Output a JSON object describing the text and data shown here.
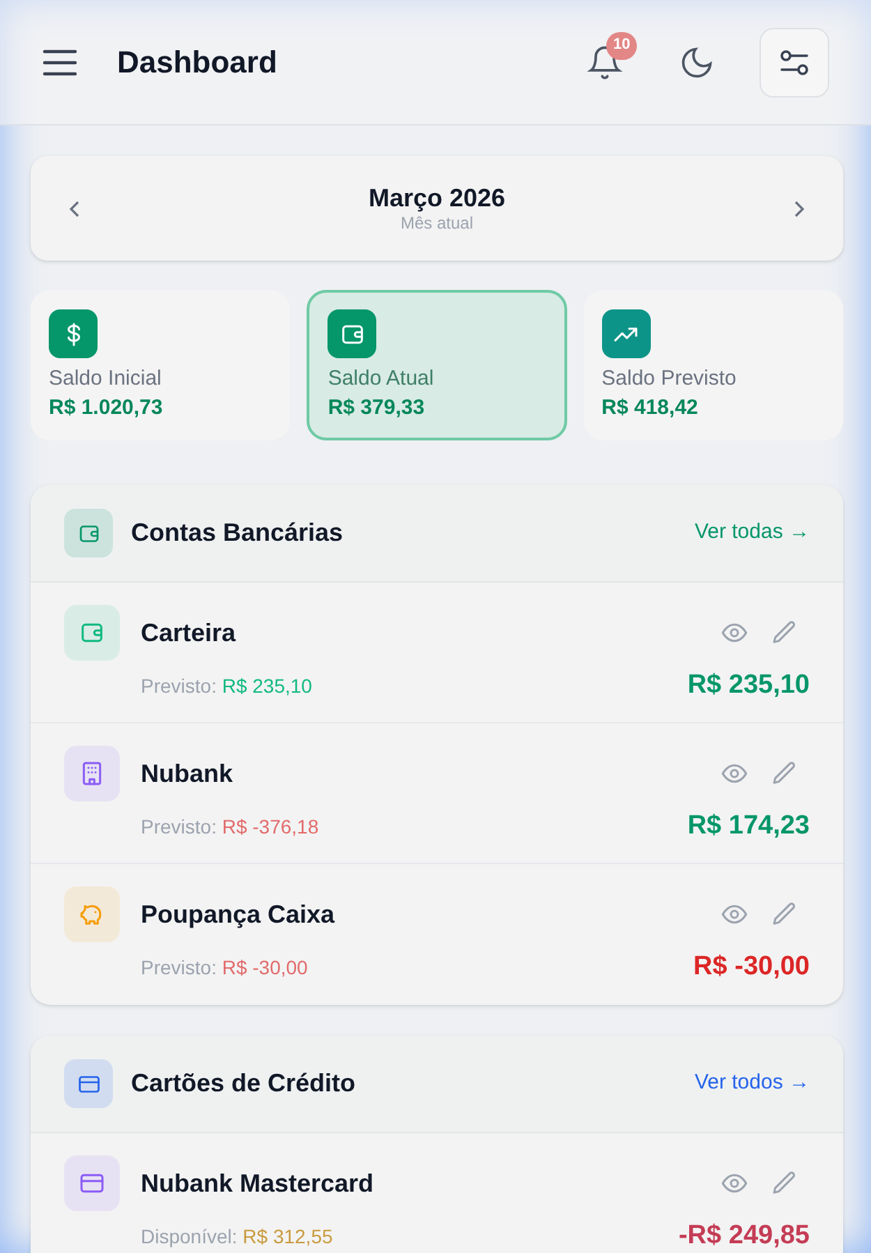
{
  "header": {
    "title": "Dashboard",
    "notification_count": "10"
  },
  "month_nav": {
    "month": "Março 2026",
    "subtitle": "Mês atual"
  },
  "summary_cards": [
    {
      "kind": "dollar",
      "label": "Saldo Inicial",
      "value": "R$ 1.020,73",
      "selected": false
    },
    {
      "kind": "wallet",
      "label": "Saldo Atual",
      "value": "R$ 379,33",
      "selected": true
    },
    {
      "kind": "trend",
      "label": "Saldo Previsto",
      "value": "R$ 418,42",
      "selected": false
    }
  ],
  "sections": [
    {
      "kind": "wallet",
      "color": "#059669",
      "title": "Contas Bancárias",
      "link": "Ver todas →",
      "items": [
        {
          "kind": "wallet",
          "color": "#10b981",
          "name": "Carteira",
          "sub_label": "Previsto:",
          "sub_value": {
            "text": "R$ 235,10",
            "color": "#10b981"
          },
          "amount": {
            "text": "R$ 235,10",
            "color": "#059669"
          }
        },
        {
          "kind": "building",
          "color": "#8b5cf6",
          "name": "Nubank",
          "sub_label": "Previsto:",
          "sub_value": {
            "text": "R$ -376,18",
            "color": "#e26a6a"
          },
          "amount": {
            "text": "R$ 174,23",
            "color": "#059669"
          }
        },
        {
          "kind": "piggy",
          "color": "#f59e0b",
          "name": "Poupança Caixa",
          "sub_label": "Previsto:",
          "sub_value": {
            "text": "R$ -30,00",
            "color": "#e26a6a"
          },
          "amount": {
            "text": "R$ -30,00",
            "color": "#dc2626"
          }
        }
      ]
    },
    {
      "kind": "card",
      "color": "#2563eb",
      "title": "Cartões de Crédito",
      "link": "Ver todos →",
      "items": [
        {
          "kind": "card",
          "color": "#8b5cf6",
          "name": "Nubank Mastercard",
          "sub_label": "Disponível:",
          "sub_value": {
            "text": "R$ 312,55",
            "color": "#c99a3e"
          },
          "amount": {
            "text": "-R$ 249,85",
            "color": "#c43c55"
          }
        }
      ]
    }
  ]
}
